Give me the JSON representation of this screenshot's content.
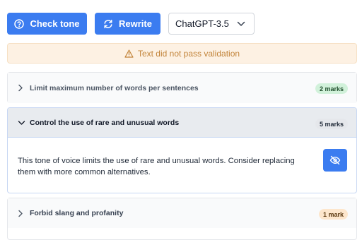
{
  "toolbar": {
    "check_tone_label": "Check tone",
    "rewrite_label": "Rewrite",
    "model_select": "ChatGPT-3.5"
  },
  "alert": {
    "message": "Text did not pass validation",
    "icon": "warning-icon",
    "color": "#c2843a"
  },
  "rules": [
    {
      "title": "Limit maximum number of words per sentences",
      "badge": "2 marks",
      "expanded": false
    },
    {
      "title": "Control the use of rare and unusual words",
      "badge": "5 marks",
      "expanded": true,
      "description": "This tone of voice limits the use of rare and unusual words. Consider replacing them with more common alternatives."
    },
    {
      "title": "Forbid slang and profanity",
      "badge": "1 mark",
      "expanded": false
    }
  ],
  "colors": {
    "accent": "#3b7cf0",
    "alert_bg": "#fdf1e3"
  }
}
